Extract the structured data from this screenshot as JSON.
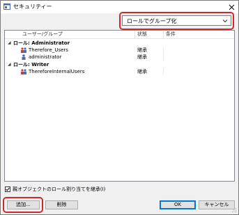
{
  "window": {
    "title": "セキュリティー"
  },
  "group_select": {
    "value": "ロールでグループ化"
  },
  "list": {
    "columns": [
      "ユーザー/グループ",
      "状態",
      "条件"
    ],
    "rows": [
      {
        "kind": "group",
        "label": "ロール: Administrator",
        "status": ""
      },
      {
        "kind": "user",
        "label": "Therefore_Users",
        "status": "継承"
      },
      {
        "kind": "user",
        "label": "administrator",
        "status": "継承"
      },
      {
        "kind": "group",
        "label": "ロール: Writer",
        "status": ""
      },
      {
        "kind": "user",
        "label": "ThereforeInternalUsers",
        "status": "継承"
      }
    ]
  },
  "inherit_checkbox": {
    "label": "親オブジェクトのロール割り当てを継承(I)",
    "checked": true
  },
  "buttons": {
    "add": "追加...",
    "delete": "削除",
    "ok": "OK",
    "cancel": "キャンセル"
  },
  "colors": {
    "highlight": "#d0292b",
    "accent": "#0078d7"
  }
}
